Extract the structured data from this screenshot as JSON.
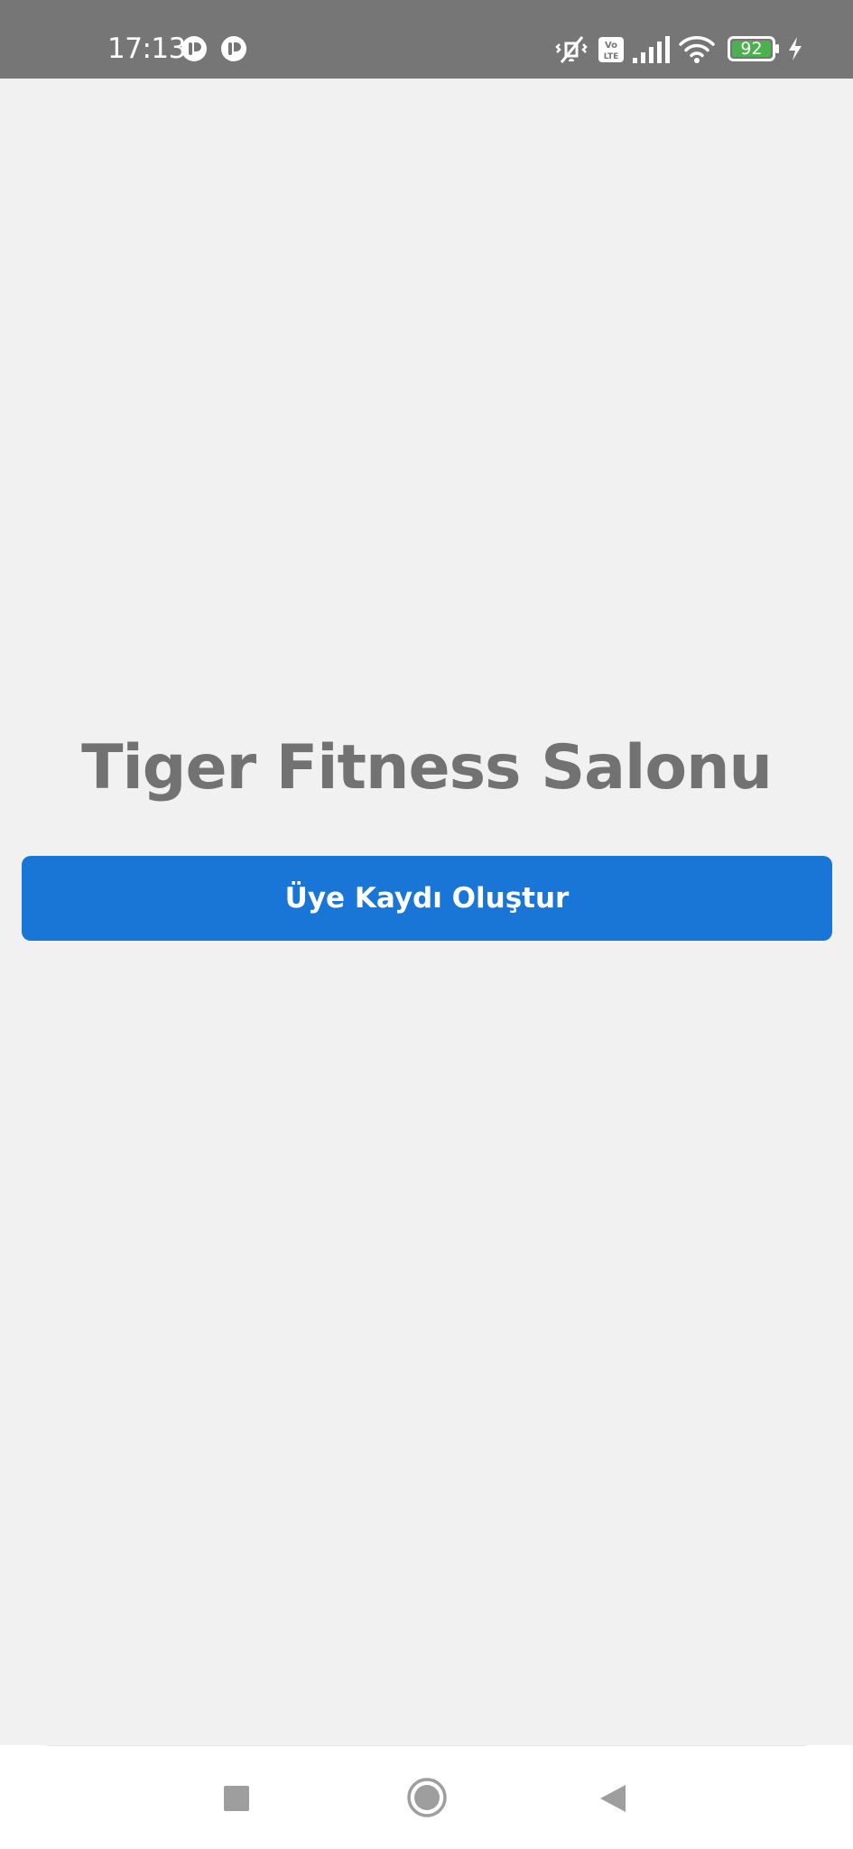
{
  "status_bar": {
    "time": "17:13",
    "battery_level": "92",
    "icons": [
      "notification-app-icon",
      "notification-app-icon",
      "vibrate-off-icon",
      "volte-icon",
      "signal-bars-icon",
      "wifi-icon",
      "battery-icon",
      "charging-bolt-icon"
    ],
    "colors": {
      "background": "#767676",
      "battery_fill": "#4caf50"
    }
  },
  "main": {
    "title": "Tiger Fitness Salonu",
    "button_label": "Üye Kaydı Oluştur",
    "colors": {
      "background": "#f1f1f2",
      "title": "#727272",
      "button": "#1a76d6"
    }
  },
  "nav_bar": {
    "buttons": [
      "recents-square-icon",
      "home-circle-icon",
      "back-triangle-icon"
    ]
  }
}
